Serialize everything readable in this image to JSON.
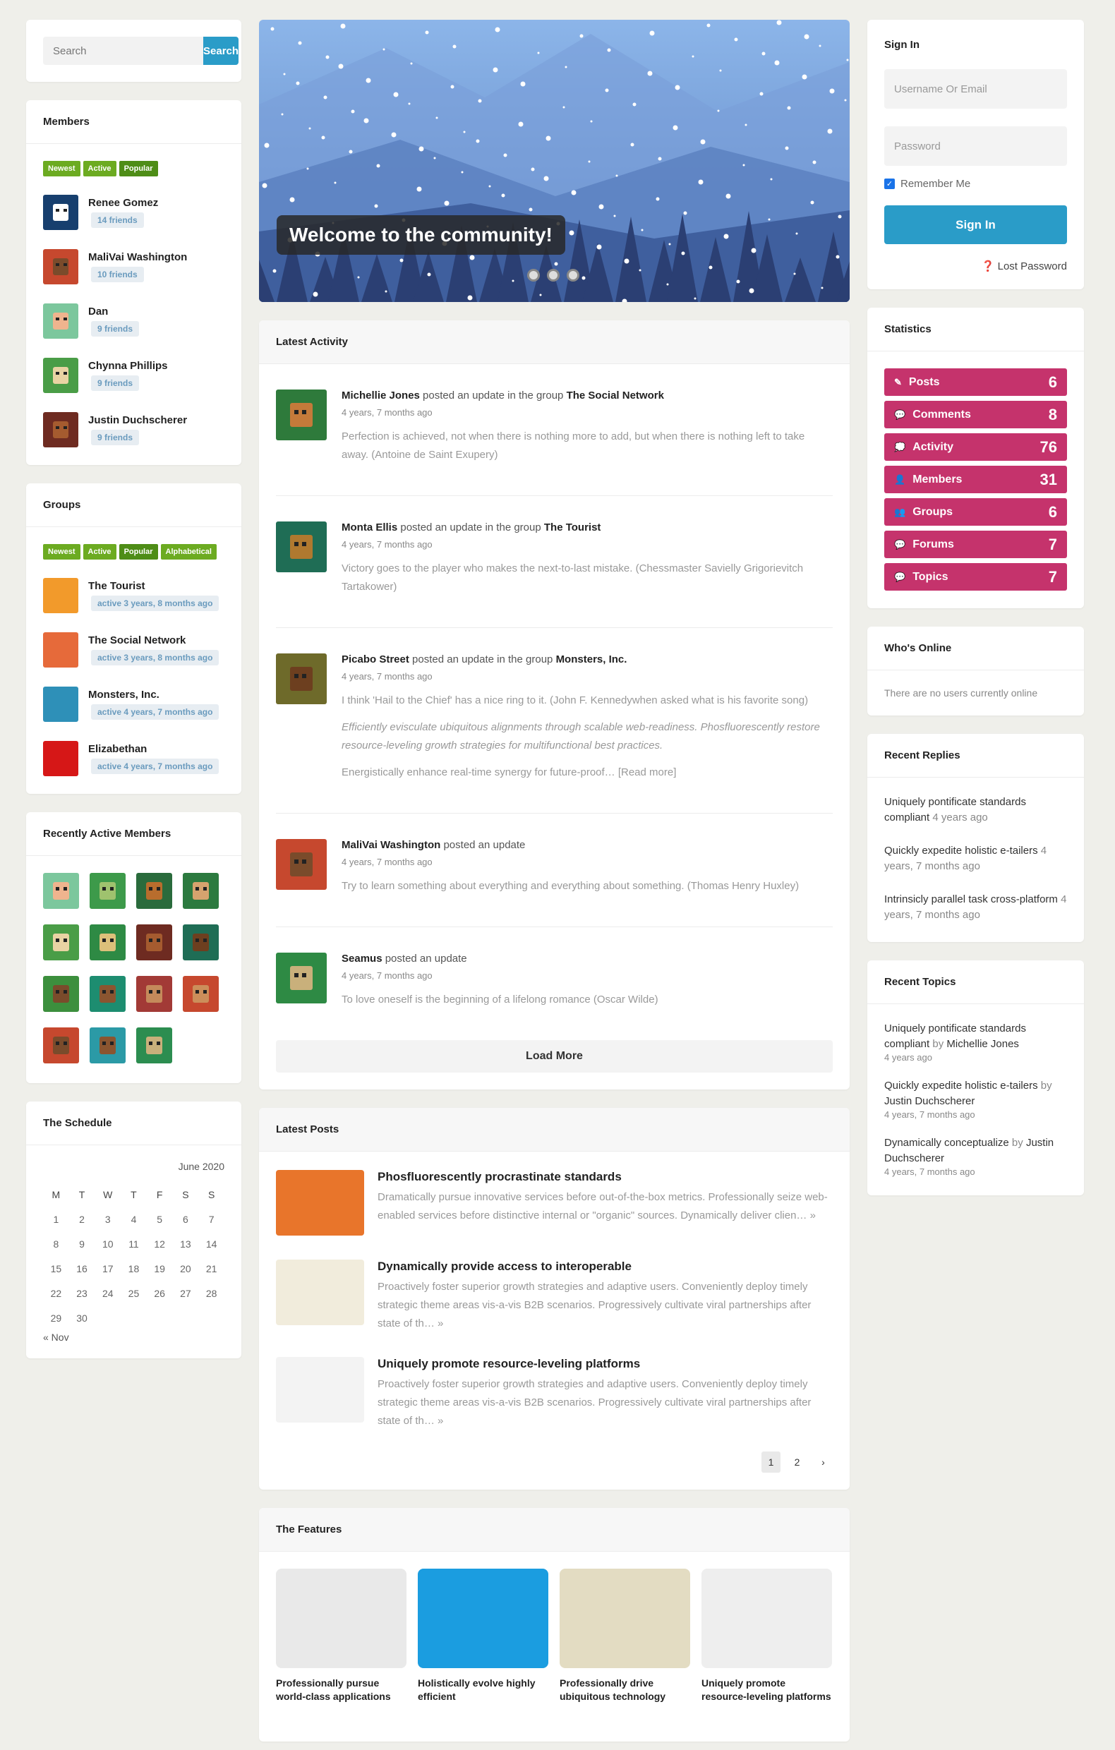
{
  "search": {
    "placeholder": "Search",
    "button": "Search"
  },
  "members": {
    "title": "Members",
    "tabs": [
      "Newest",
      "Active",
      "Popular"
    ],
    "list": [
      {
        "name": "Renee Gomez",
        "friends": "14 friends",
        "color": "#173f6e",
        "face": "#fff"
      },
      {
        "name": "MaliVai Washington",
        "friends": "10 friends",
        "color": "#c6482e",
        "face": "#7a4b2b"
      },
      {
        "name": "Dan",
        "friends": "9 friends",
        "color": "#7cc79d",
        "face": "#efb48e"
      },
      {
        "name": "Chynna Phillips",
        "friends": "9 friends",
        "color": "#4a9d47",
        "face": "#e9d3a3"
      },
      {
        "name": "Justin Duchscherer",
        "friends": "9 friends",
        "color": "#6e2b21",
        "face": "#a55b2f"
      }
    ]
  },
  "groups": {
    "title": "Groups",
    "tabs": [
      "Newest",
      "Active",
      "Popular",
      "Alphabetical"
    ],
    "list": [
      {
        "name": "The Tourist",
        "meta": "active 3 years, 8 months ago",
        "color": "#f29a2b"
      },
      {
        "name": "The Social Network",
        "meta": "active 3 years, 8 months ago",
        "color": "#e66a3a"
      },
      {
        "name": "Monsters, Inc.",
        "meta": "active 4 years, 7 months ago",
        "color": "#2e90b8"
      },
      {
        "name": "Elizabethan",
        "meta": "active 4 years, 7 months ago",
        "color": "#d61717"
      }
    ]
  },
  "recent_members": {
    "title": "Recently Active Members",
    "avatars": [
      {
        "c": "#7cc79d",
        "f": "#efb48e"
      },
      {
        "c": "#3d9a4a",
        "f": "#9fc26e"
      },
      {
        "c": "#2a6b3c",
        "f": "#b86d2d"
      },
      {
        "c": "#2c7a3f",
        "f": "#d6a36e"
      },
      {
        "c": "#4a9d47",
        "f": "#e9d3a3"
      },
      {
        "c": "#2e8a44",
        "f": "#dcc07a"
      },
      {
        "c": "#6e2b21",
        "f": "#a55b2f"
      },
      {
        "c": "#1f6d55",
        "f": "#6d3f1f"
      },
      {
        "c": "#3c8f3d",
        "f": "#7a4b2b"
      },
      {
        "c": "#1d8d70",
        "f": "#8a5530"
      },
      {
        "c": "#a23a36",
        "f": "#c58a5b"
      },
      {
        "c": "#c6482e",
        "f": "#cc8e5a"
      },
      {
        "c": "#c6482e",
        "f": "#7a4b2b"
      },
      {
        "c": "#2b9aa6",
        "f": "#8a5530"
      },
      {
        "c": "#2c8d50",
        "f": "#c9b07b"
      }
    ]
  },
  "schedule": {
    "title": "The Schedule",
    "month": "June 2020",
    "days": [
      "M",
      "T",
      "W",
      "T",
      "F",
      "S",
      "S"
    ],
    "weeks": [
      [
        "1",
        "2",
        "3",
        "4",
        "5",
        "6",
        "7"
      ],
      [
        "8",
        "9",
        "10",
        "11",
        "12",
        "13",
        "14"
      ],
      [
        "15",
        "16",
        "17",
        "18",
        "19",
        "20",
        "21"
      ],
      [
        "22",
        "23",
        "24",
        "25",
        "26",
        "27",
        "28"
      ],
      [
        "29",
        "30",
        "",
        "",
        "",
        "",
        ""
      ]
    ],
    "prev": "« Nov"
  },
  "slider": {
    "caption": "Welcome to the community!"
  },
  "activity": {
    "title": "Latest Activity",
    "load_more": "Load More",
    "items": [
      {
        "user": "Michellie Jones",
        "action": "posted an update in the group",
        "group": "The Social Network",
        "time": "4 years, 7 months ago",
        "texts": [
          {
            "t": "Perfection is achieved, not when there is nothing more to add, but when there is nothing left to take away. (Antoine de Saint Exupery)",
            "i": false
          }
        ],
        "color": "#2e7a3b",
        "face": "#c47a3a"
      },
      {
        "user": "Monta Ellis",
        "action": "posted an update in the group",
        "group": "The Tourist",
        "time": "4 years, 7 months ago",
        "texts": [
          {
            "t": "Victory goes to the player who makes the next-to-last mistake. (Chessmaster Savielly Grigorievitch Tartakower)",
            "i": false
          }
        ],
        "color": "#1f6d55",
        "face": "#b0792f"
      },
      {
        "user": "Picabo Street",
        "action": "posted an update in the group",
        "group": "Monsters, Inc.",
        "time": "4 years, 7 months ago",
        "texts": [
          {
            "t": "I think 'Hail to the Chief' has a nice ring to it. (John F. Kennedywhen asked what is his favorite song)",
            "i": false
          },
          {
            "t": "Efficiently evisculate ubiquitous alignments through scalable web-readiness. Phosfluorescently restore resource-leveling growth strategies for multifunctional best practices.",
            "i": true
          },
          {
            "t": "Energistically enhance real-time synergy for future-proof…     [Read more]",
            "i": false
          }
        ],
        "color": "#6e6a2a",
        "face": "#6d3f1f"
      },
      {
        "user": "MaliVai Washington",
        "action": "posted an update",
        "group": "",
        "time": "4 years, 7 months ago",
        "texts": [
          {
            "t": "Try to learn something about everything and everything about something. (Thomas Henry Huxley)",
            "i": false
          }
        ],
        "color": "#c6482e",
        "face": "#7a4b2b"
      },
      {
        "user": "Seamus",
        "action": "posted an update",
        "group": "",
        "time": "4 years, 7 months ago",
        "texts": [
          {
            "t": "To love oneself is the beginning of a lifelong romance (Oscar Wilde)",
            "i": false
          }
        ],
        "color": "#2e8a44",
        "face": "#c9b07b"
      }
    ]
  },
  "posts": {
    "title": "Latest Posts",
    "items": [
      {
        "title": "Phosfluorescently procrastinate standards",
        "excerpt": "Dramatically pursue innovative services before out-of-the-box metrics. Professionally seize web-enabled services before distinctive internal or \"organic\" sources. Dynamically deliver clien…  »",
        "color": "#e8752b"
      },
      {
        "title": "Dynamically provide access to interoperable",
        "excerpt": "Proactively foster superior growth strategies and adaptive users. Conveniently deploy timely strategic theme areas vis-a-vis B2B scenarios. Progressively cultivate viral partnerships after state of th…  »",
        "color": "#f1ecdc"
      },
      {
        "title": "Uniquely promote resource-leveling platforms",
        "excerpt": "Proactively foster superior growth strategies and adaptive users. Conveniently deploy timely strategic theme areas vis-a-vis B2B scenarios. Progressively cultivate viral partnerships after state of th…  »",
        "color": "#f3f3f3"
      }
    ],
    "pages": [
      "1",
      "2",
      "›"
    ]
  },
  "features": {
    "title": "The Features",
    "items": [
      {
        "title": "Professionally pursue world-class applications",
        "color": "#e9e9e9"
      },
      {
        "title": "Holistically evolve highly efficient",
        "color": "#1b9de0"
      },
      {
        "title": "Professionally drive ubiquitous technology",
        "color": "#e3dcc2"
      },
      {
        "title": "Uniquely promote resource-leveling platforms",
        "color": "#eeeeee"
      }
    ]
  },
  "signin": {
    "title": "Sign In",
    "username_placeholder": "Username Or Email",
    "password_placeholder": "Password",
    "remember": "Remember Me",
    "button": "Sign In",
    "lost": "Lost Password"
  },
  "stats": {
    "title": "Statistics",
    "accent": "#c5336c",
    "items": [
      {
        "label": "Posts",
        "value": "6",
        "icon": "✎"
      },
      {
        "label": "Comments",
        "value": "8",
        "icon": "💬"
      },
      {
        "label": "Activity",
        "value": "76",
        "icon": "💭"
      },
      {
        "label": "Members",
        "value": "31",
        "icon": "👤"
      },
      {
        "label": "Groups",
        "value": "6",
        "icon": "👥"
      },
      {
        "label": "Forums",
        "value": "7",
        "icon": "💬"
      },
      {
        "label": "Topics",
        "value": "7",
        "icon": "💬"
      }
    ]
  },
  "online": {
    "title": "Who's Online",
    "text": "There are no users currently online"
  },
  "replies": {
    "title": "Recent Replies",
    "items": [
      {
        "text": "Uniquely pontificate standards compliant",
        "ago": "4 years ago"
      },
      {
        "text": "Quickly expedite holistic e-tailers",
        "ago": "4 years, 7 months ago"
      },
      {
        "text": "Intrinsicly parallel task cross-platform",
        "ago": "4 years, 7 months ago"
      }
    ]
  },
  "topics": {
    "title": "Recent Topics",
    "items": [
      {
        "text": "Uniquely pontificate standards compliant",
        "by": "by",
        "author": "Michellie Jones",
        "ago": "4 years ago"
      },
      {
        "text": "Quickly expedite holistic e-tailers",
        "by": "by",
        "author": "Justin Duchscherer",
        "ago": "4 years, 7 months ago"
      },
      {
        "text": "Dynamically conceptualize",
        "by": "by",
        "author": "Justin Duchscherer",
        "ago": "4 years, 7 months ago"
      }
    ]
  }
}
